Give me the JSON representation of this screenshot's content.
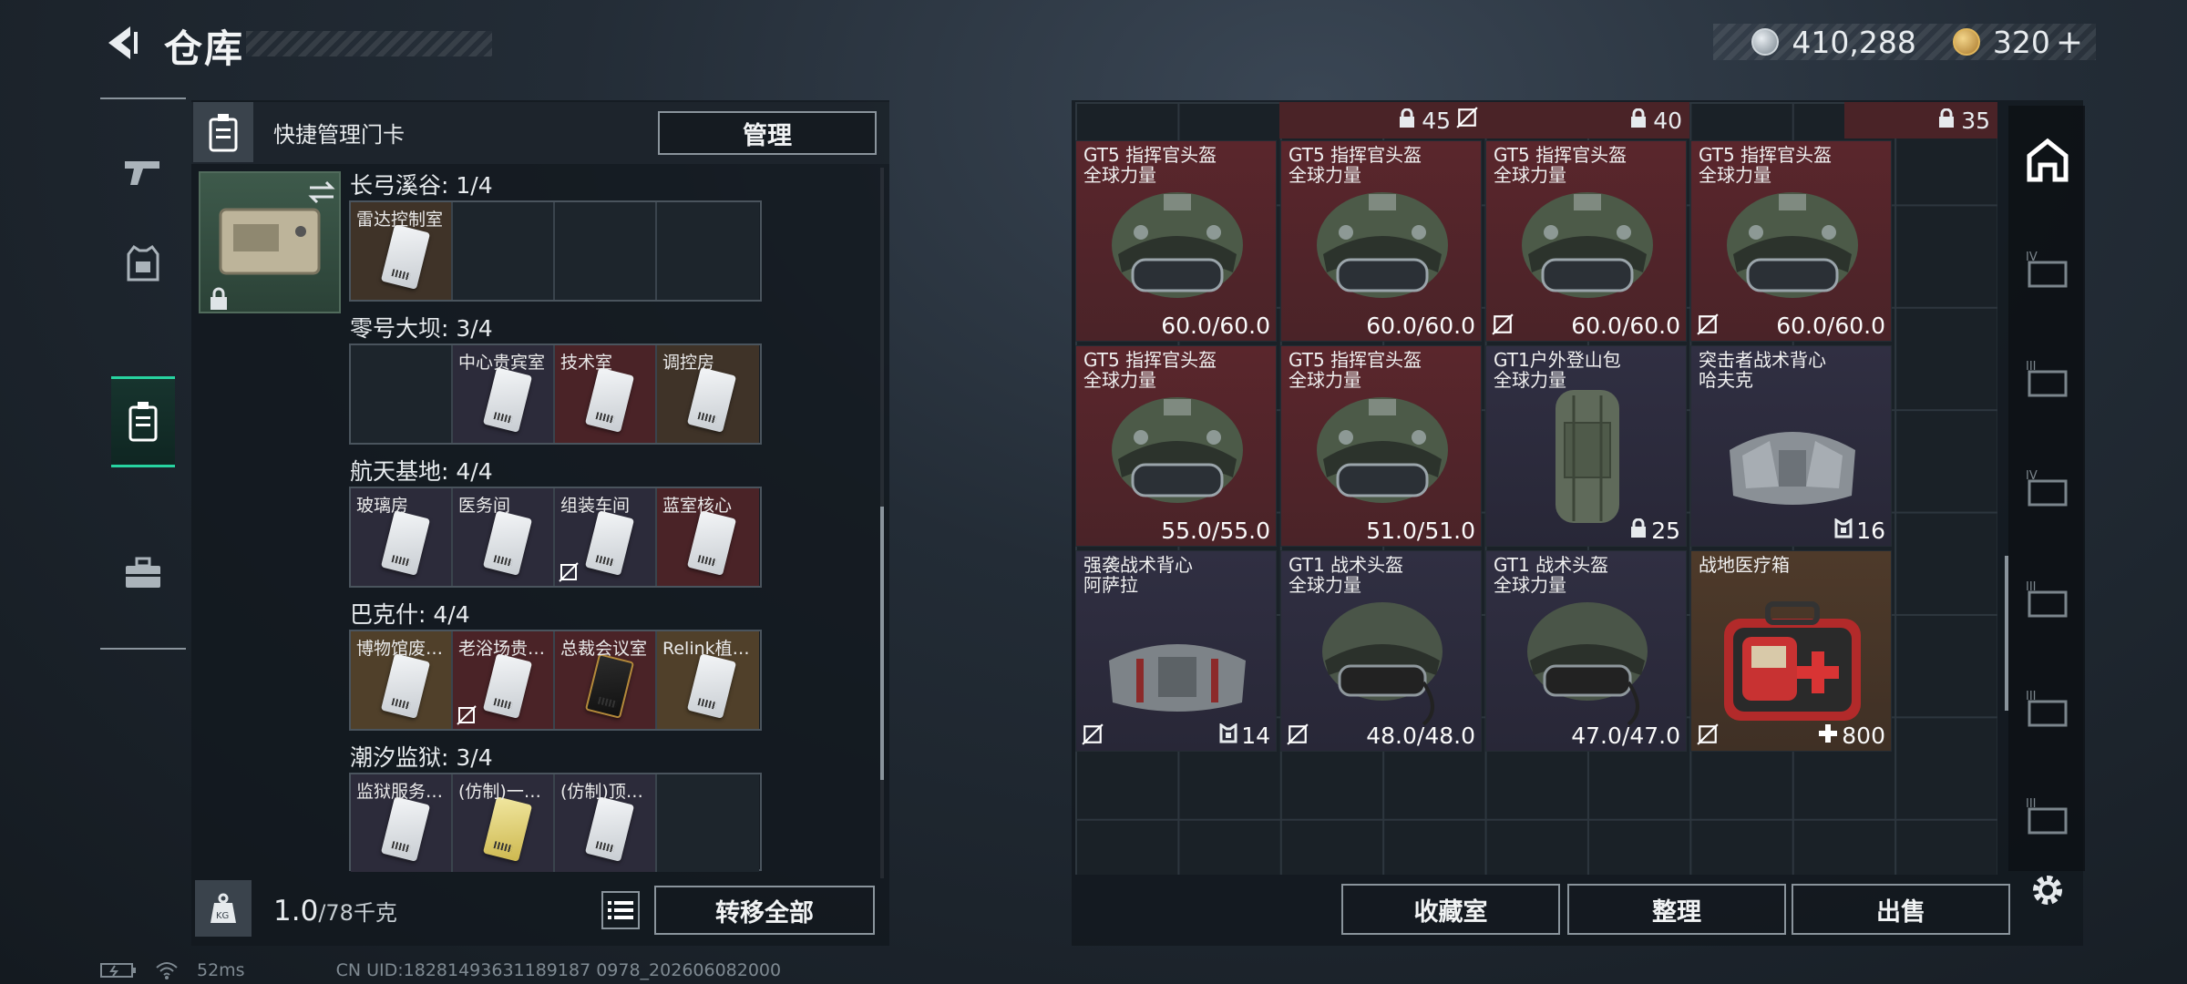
{
  "header": {
    "title": "仓库",
    "silver_amount": "410,288",
    "gold_amount": "320",
    "gold_plus": "+"
  },
  "left_panel": {
    "quick_title": "快捷管理门卡",
    "manage_label": "管理",
    "sections": [
      {
        "title": "长弓溪谷: 1/4",
        "slots": [
          {
            "label": "雷达控制室",
            "tone": "brown",
            "card": "white",
            "nobind": false
          },
          {
            "label": "",
            "tone": "empty"
          },
          {
            "label": "",
            "tone": "empty"
          },
          {
            "label": "",
            "tone": "empty"
          }
        ]
      },
      {
        "title": "零号大坝: 3/4",
        "slots": [
          {
            "label": "",
            "tone": "empty"
          },
          {
            "label": "中心贵宾室",
            "tone": "purple",
            "card": "white",
            "nobind": false
          },
          {
            "label": "技术室",
            "tone": "red",
            "card": "white",
            "nobind": false
          },
          {
            "label": "调控房",
            "tone": "brown",
            "card": "white",
            "nobind": false
          }
        ]
      },
      {
        "title": "航天基地: 4/4",
        "slots": [
          {
            "label": "玻璃房",
            "tone": "purple",
            "card": "white",
            "nobind": false
          },
          {
            "label": "医务间",
            "tone": "purple",
            "card": "white",
            "nobind": false
          },
          {
            "label": "组装车间",
            "tone": "purple",
            "card": "white",
            "nobind": true
          },
          {
            "label": "蓝室核心",
            "tone": "red",
            "card": "white",
            "nobind": false
          }
        ]
      },
      {
        "title": "巴克什: 4/4",
        "slots": [
          {
            "label": "博物馆废…",
            "tone": "gold",
            "card": "white",
            "nobind": false
          },
          {
            "label": "老浴场贵…",
            "tone": "red",
            "card": "white",
            "nobind": true
          },
          {
            "label": "总裁会议室",
            "tone": "red",
            "card": "black",
            "nobind": false
          },
          {
            "label": "Relink植…",
            "tone": "gold",
            "card": "white",
            "nobind": false
          }
        ]
      },
      {
        "title": "潮汐监狱: 3/4",
        "slots": [
          {
            "label": "监狱服务…",
            "tone": "purple",
            "card": "white",
            "nobind": false
          },
          {
            "label": "(仿制)一…",
            "tone": "purple",
            "card": "yellow",
            "nobind": false
          },
          {
            "label": "(仿制)顶…",
            "tone": "purple",
            "card": "white",
            "nobind": false
          },
          {
            "label": "",
            "tone": "empty"
          }
        ]
      }
    ],
    "weight_value": "1.0",
    "weight_unit": "/78千克",
    "transfer_all_label": "转移全部"
  },
  "inventory": {
    "top_strip": [
      "45",
      "40",
      "35"
    ],
    "items": [
      {
        "name": "GT5 指挥官头盔\n全球力量",
        "value": "60.0/60.0",
        "tone": "red",
        "art": "helmet",
        "nobind": false
      },
      {
        "name": "GT5 指挥官头盔\n全球力量",
        "value": "60.0/60.0",
        "tone": "red",
        "art": "helmet",
        "nobind": false
      },
      {
        "name": "GT5 指挥官头盔\n全球力量",
        "value": "60.0/60.0",
        "tone": "red",
        "art": "helmet",
        "nobind": true
      },
      {
        "name": "GT5 指挥官头盔\n全球力量",
        "value": "60.0/60.0",
        "tone": "red",
        "art": "helmet",
        "nobind": true
      },
      {
        "name": "GT5 指挥官头盔\n全球力量",
        "value": "55.0/55.0",
        "tone": "red",
        "art": "helmet",
        "nobind": false
      },
      {
        "name": "GT5 指挥官头盔\n全球力量",
        "value": "51.0/51.0",
        "tone": "red",
        "art": "helmet",
        "nobind": false
      },
      {
        "name": "GT1户外登山包\n全球力量",
        "value": "25",
        "tone": "purple",
        "art": "backpack",
        "nobind": false,
        "icon": "capacity"
      },
      {
        "name": "突击者战术背心\n哈夫克",
        "value": "16",
        "tone": "purple",
        "art": "vest",
        "nobind": false,
        "icon": "armor"
      },
      {
        "name": "强袭战术背心\n阿萨拉",
        "value": "14",
        "tone": "purple",
        "art": "vest-red",
        "nobind": true,
        "icon": "armor"
      },
      {
        "name": "GT1 战术头盔\n全球力量",
        "value": "48.0/48.0",
        "tone": "purple",
        "art": "helmet2",
        "nobind": true
      },
      {
        "name": "GT1 战术头盔\n全球力量",
        "value": "47.0/47.0",
        "tone": "purple",
        "art": "helmet2",
        "nobind": false
      },
      {
        "name": "战地医疗箱",
        "value": "800",
        "tone": "brown",
        "art": "medkit",
        "nobind": true,
        "icon": "heal"
      }
    ],
    "buttons": {
      "collection": "收藏室",
      "sort": "整理",
      "sell": "出售"
    }
  },
  "status": {
    "ping": "52ms",
    "uid": "CN UID:18281493631189187 0978_202606082000"
  }
}
